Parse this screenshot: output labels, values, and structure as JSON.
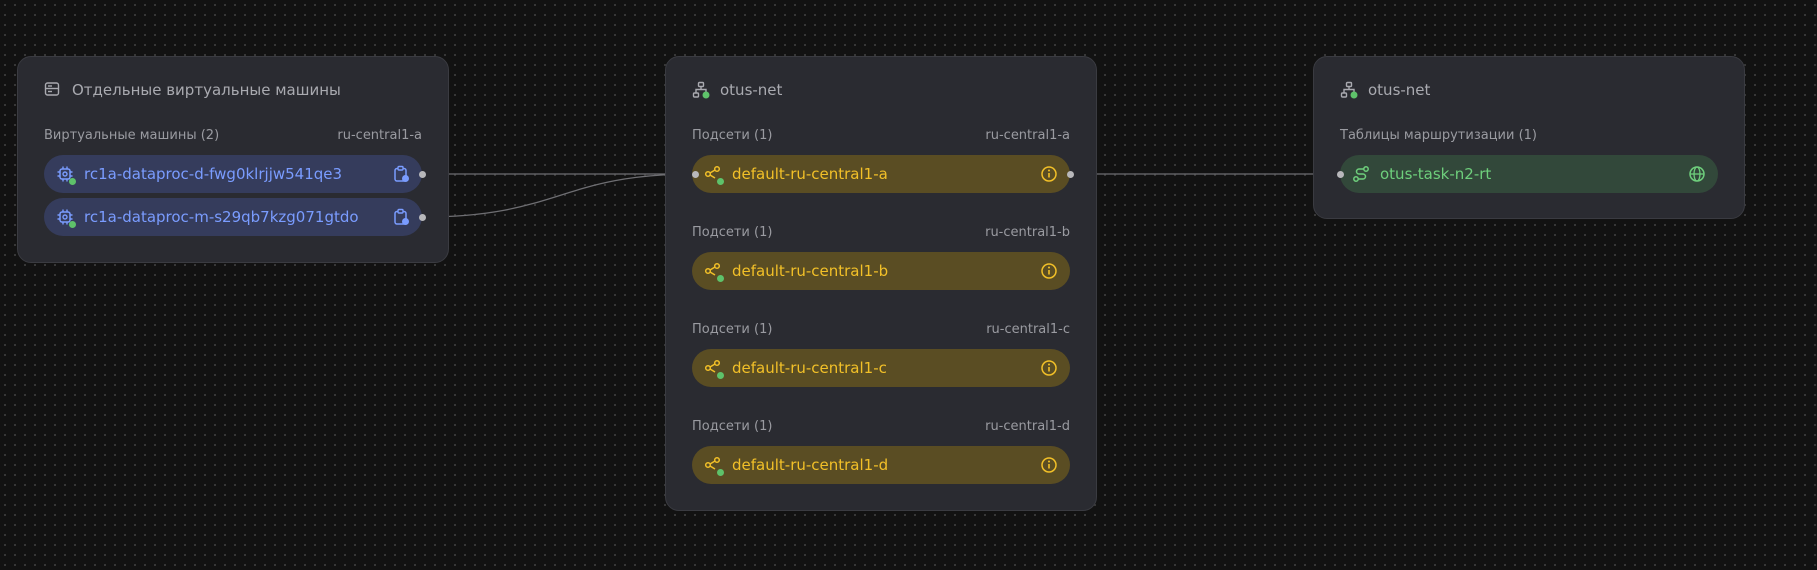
{
  "vm_group": {
    "title": "Отдельные виртуальные машины",
    "section_label": "Виртуальные машины (2)",
    "zone": "ru-central1-a",
    "items": [
      {
        "label": "rc1a-dataproc-d-fwg0klrjjw541qe3"
      },
      {
        "label": "rc1a-dataproc-m-s29qb7kzg071gtdo"
      }
    ]
  },
  "network_group": {
    "title": "otus-net",
    "subnets": [
      {
        "section_label": "Подсети (1)",
        "zone": "ru-central1-a",
        "label": "default-ru-central1-a"
      },
      {
        "section_label": "Подсети (1)",
        "zone": "ru-central1-b",
        "label": "default-ru-central1-b"
      },
      {
        "section_label": "Подсети (1)",
        "zone": "ru-central1-c",
        "label": "default-ru-central1-c"
      },
      {
        "section_label": "Подсети (1)",
        "zone": "ru-central1-d",
        "label": "default-ru-central1-d"
      }
    ]
  },
  "route_group": {
    "title": "otus-net",
    "section_label": "Таблицы маршрутизации (1)",
    "items": [
      {
        "label": "otus-task-n2-rt"
      }
    ]
  },
  "colors": {
    "background": "#121212",
    "card": "#2a2b31",
    "vm_accent": "#7a9cff",
    "subnet_accent": "#f2c028",
    "route_accent": "#6ecf7c",
    "status_ok": "#5ec26a"
  },
  "icons": {
    "vm_group": "server-list-icon",
    "network": "network-icon",
    "vm": "cpu-chip-icon",
    "vm_action": "clipboard-icon",
    "subnet": "subnet-share-icon",
    "subnet_info": "info-icon",
    "route_table": "route-icon",
    "route_globe": "globe-icon"
  }
}
